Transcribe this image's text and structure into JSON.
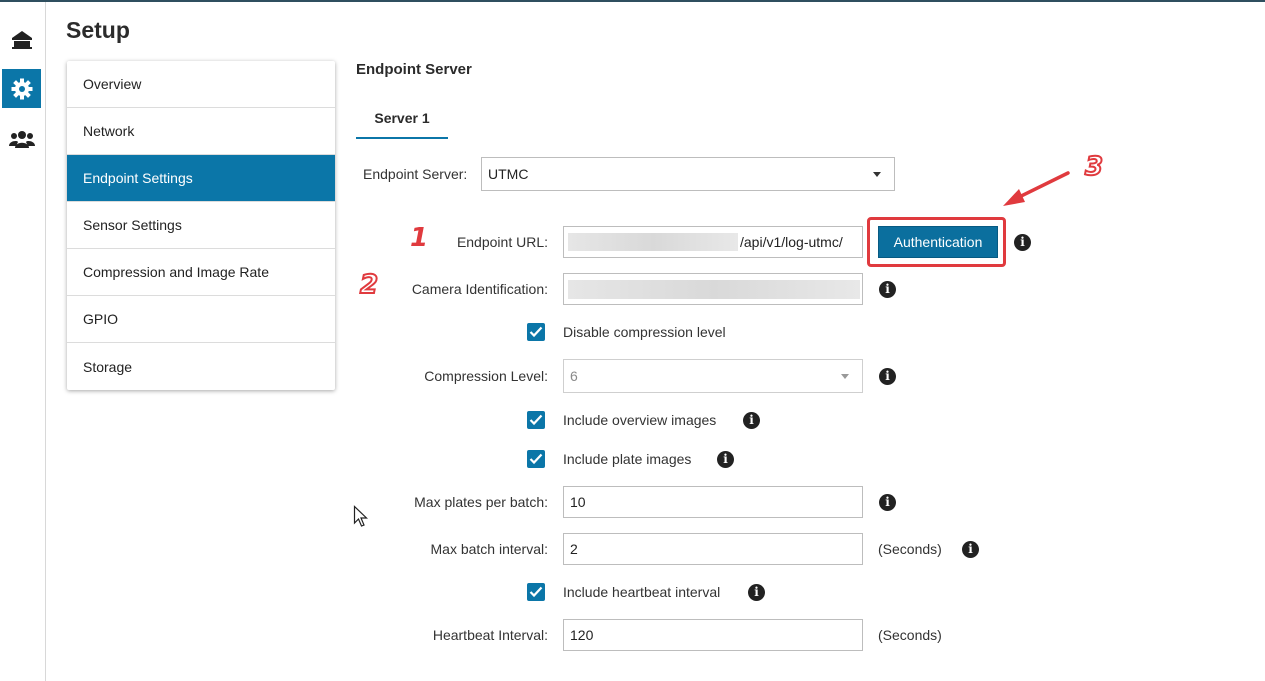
{
  "app": {
    "page_title": "Setup"
  },
  "rail": {
    "items": [
      {
        "name": "home",
        "icon": "home-icon",
        "active": false
      },
      {
        "name": "setup",
        "icon": "gear-icon",
        "active": true
      },
      {
        "name": "users",
        "icon": "users-icon",
        "active": false
      }
    ]
  },
  "menu": {
    "items": [
      {
        "label": "Overview"
      },
      {
        "label": "Network"
      },
      {
        "label": "Endpoint Settings",
        "active": true
      },
      {
        "label": "Sensor Settings"
      },
      {
        "label": "Compression and Image Rate"
      },
      {
        "label": "GPIO"
      },
      {
        "label": "Storage"
      }
    ]
  },
  "section": {
    "title": "Endpoint Server",
    "tab_label": "Server 1"
  },
  "form": {
    "endpoint_server_label": "Endpoint Server:",
    "endpoint_server_value": "UTMC",
    "endpoint_url_label": "Endpoint URL:",
    "endpoint_url_value": "/api/v1/log-utmc/",
    "authentication_button": "Authentication",
    "camera_id_label": "Camera Identification:",
    "disable_compression_label": "Disable compression level",
    "disable_compression_checked": true,
    "compression_level_label": "Compression Level:",
    "compression_level_value": "6",
    "include_overview_label": "Include overview images",
    "include_overview_checked": true,
    "include_plate_label": "Include plate images",
    "include_plate_checked": true,
    "max_plates_label": "Max plates per batch:",
    "max_plates_value": "10",
    "max_batch_interval_label": "Max batch interval:",
    "max_batch_interval_value": "2",
    "max_batch_interval_unit": "(Seconds)",
    "include_heartbeat_label": "Include heartbeat interval",
    "include_heartbeat_checked": true,
    "heartbeat_interval_label": "Heartbeat Interval:",
    "heartbeat_interval_value": "120",
    "heartbeat_interval_unit": "(Seconds)"
  },
  "annotations": {
    "one": "1",
    "two": "2",
    "three": "3"
  },
  "colors": {
    "accent": "#0b76a8",
    "annotation": "#e03a3e"
  }
}
